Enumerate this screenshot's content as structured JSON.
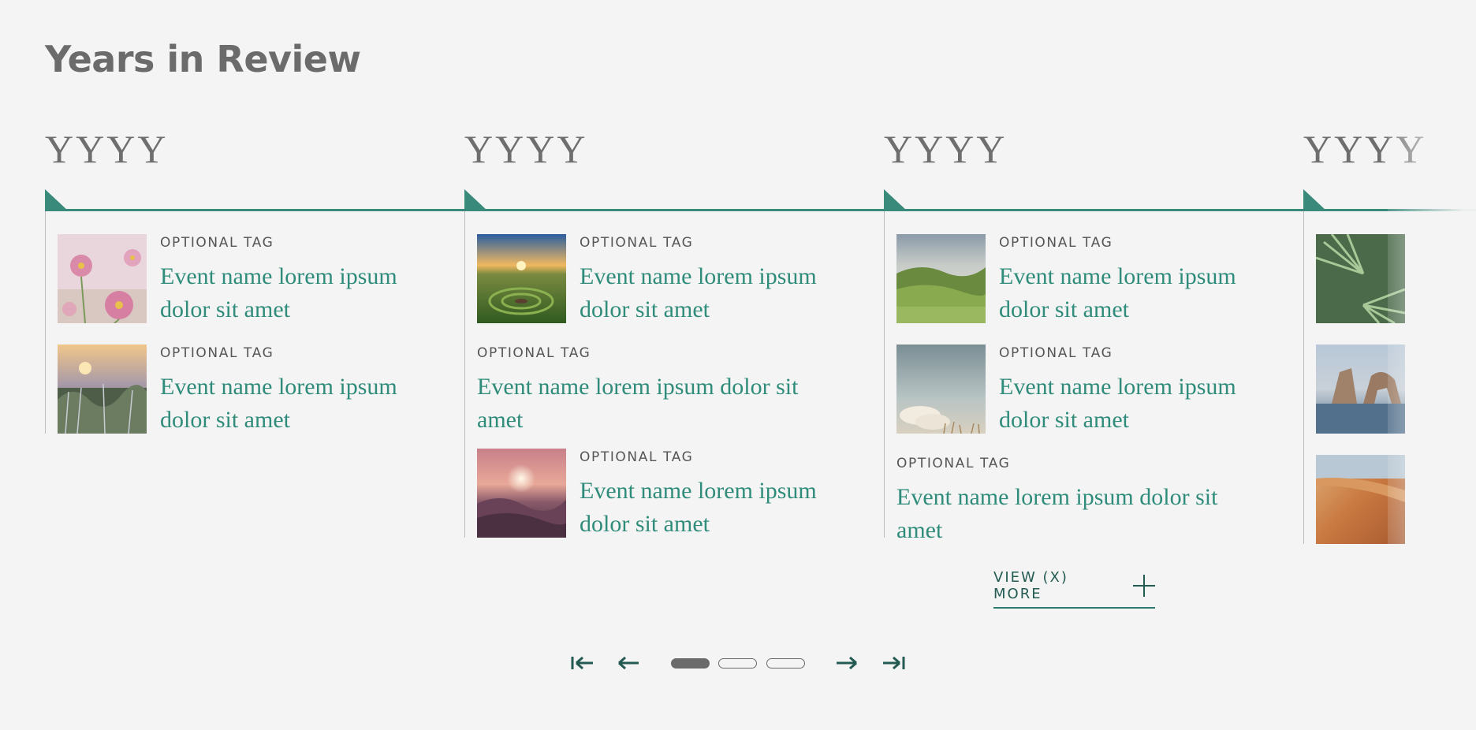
{
  "page": {
    "title": "Years in Review"
  },
  "columns": [
    {
      "year": "YYYY",
      "items": [
        {
          "tag": "OPTIONAL TAG",
          "event": "Event name lorem ipsum dolor sit amet",
          "image": "pink-daisies"
        },
        {
          "tag": "OPTIONAL TAG",
          "event": "Event name lorem ipsum dolor sit amet",
          "image": "sunset-meadow"
        }
      ]
    },
    {
      "year": "YYYY",
      "items": [
        {
          "tag": "OPTIONAL TAG",
          "event": "Event name lorem ipsum dolor sit amet",
          "image": "stone-spiral-sunset"
        },
        {
          "tag": "OPTIONAL TAG",
          "event": "Event name lorem ipsum dolor sit amet",
          "image": ""
        },
        {
          "tag": "OPTIONAL TAG",
          "event": "Event name lorem ipsum dolor sit amet",
          "image": "misty-sunset"
        }
      ]
    },
    {
      "year": "YYYY",
      "items": [
        {
          "tag": "OPTIONAL TAG",
          "event": "Event name lorem ipsum dolor sit amet",
          "image": "green-hills"
        },
        {
          "tag": "OPTIONAL TAG",
          "event": "Event name lorem ipsum dolor sit amet",
          "image": "cloudy-sky"
        },
        {
          "tag": "OPTIONAL TAG",
          "event": "Event name lorem ipsum dolor sit amet",
          "image": ""
        }
      ]
    },
    {
      "year": "YYYY",
      "items": [
        {
          "tag": "",
          "event": "",
          "image": "palm-leaves"
        },
        {
          "tag": "",
          "event": "",
          "image": "sea-arch"
        },
        {
          "tag": "",
          "event": "",
          "image": "desert-dunes"
        }
      ]
    }
  ],
  "view_more": {
    "label": "VIEW (X) MORE"
  },
  "pagination": {
    "pages": 3,
    "current": 1,
    "first_icon": "skip-first-icon",
    "prev_icon": "arrow-left-icon",
    "next_icon": "arrow-right-icon",
    "last_icon": "skip-last-icon"
  },
  "colors": {
    "accent": "#3a8a7c",
    "event_text": "#2f8c7a",
    "dark_accent": "#235a52",
    "text_gray": "#6b6b6b",
    "background": "#f4f4f4"
  }
}
